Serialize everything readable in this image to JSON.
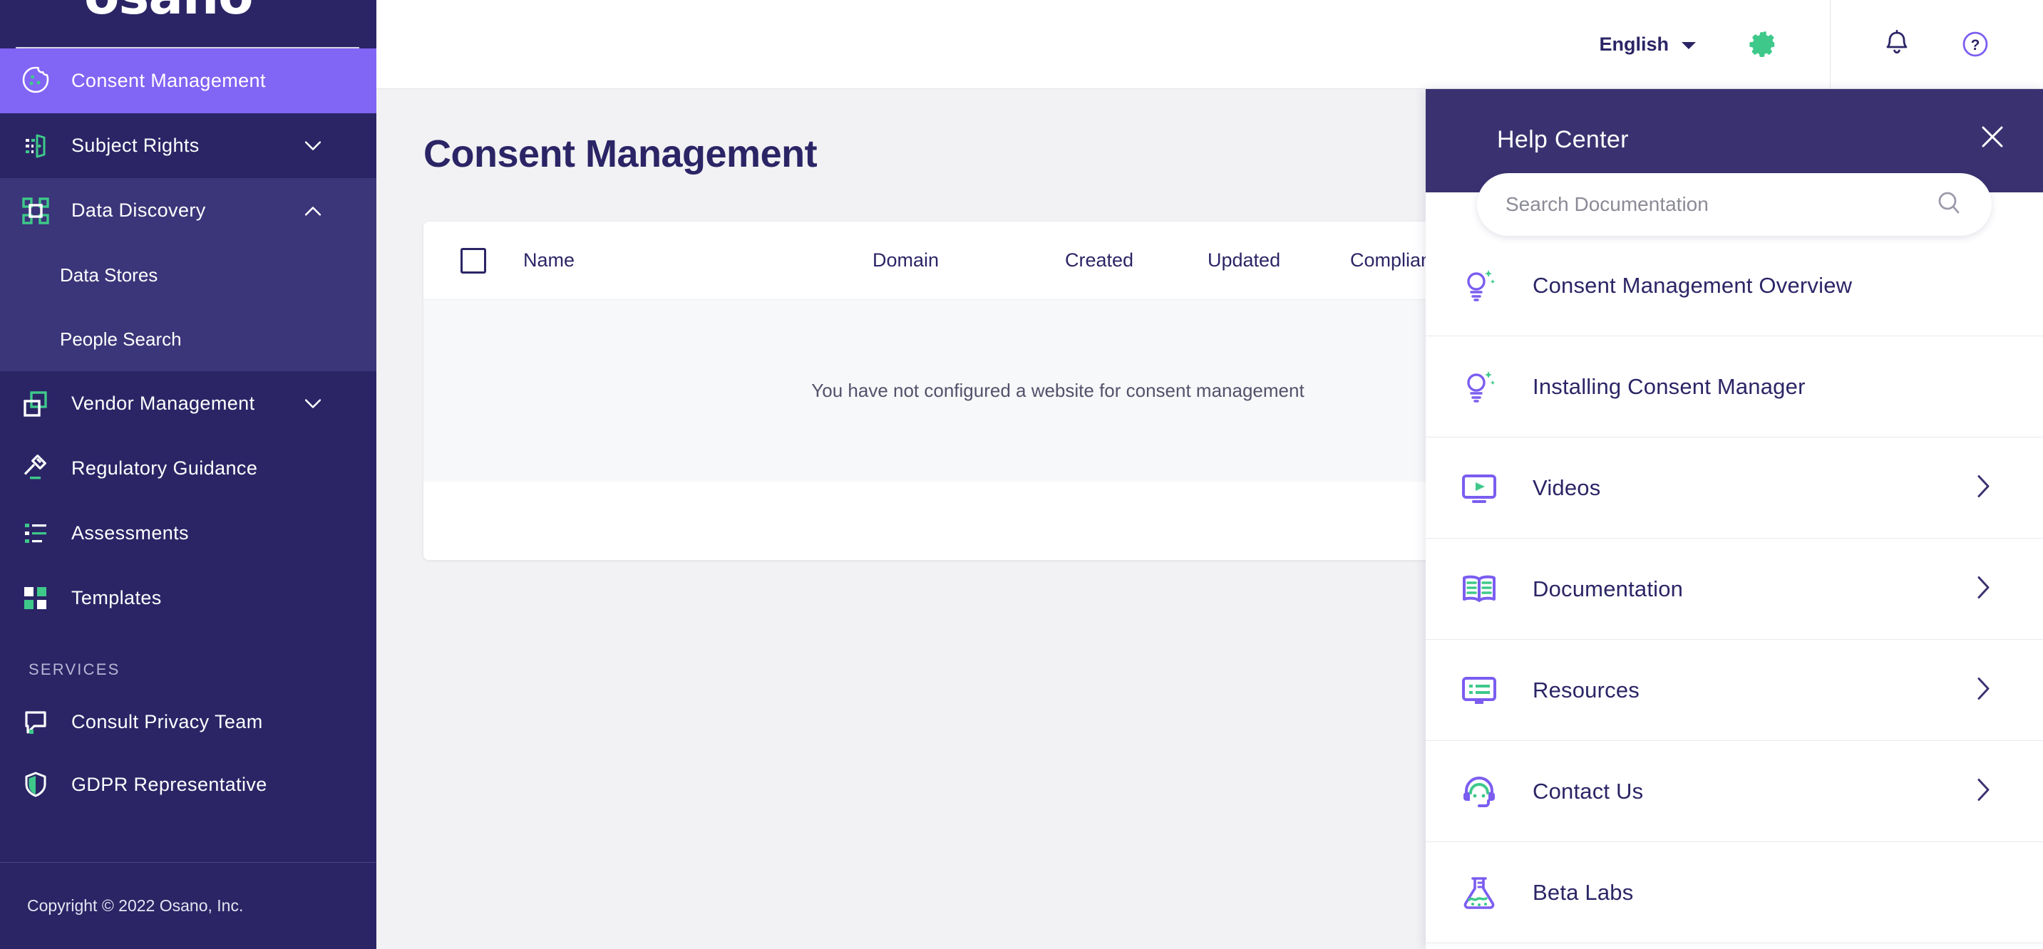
{
  "brand": {
    "logo_text": "osano",
    "accent_purple": "#8165f4",
    "accent_green": "#3ec98a",
    "dark_navy": "#2b2566",
    "panel_header": "#3a3270"
  },
  "sidebar": {
    "items": [
      {
        "label": "Consent Management",
        "icon": "cookie-icon",
        "active": true,
        "expandable": false
      },
      {
        "label": "Subject Rights",
        "icon": "door-exit-icon",
        "active": false,
        "expandable": true,
        "expanded": false
      },
      {
        "label": "Data Discovery",
        "icon": "scan-frame-icon",
        "active": false,
        "expandable": true,
        "expanded": true
      },
      {
        "label": "Vendor Management",
        "icon": "overlapping-squares-icon",
        "active": false,
        "expandable": true,
        "expanded": false
      },
      {
        "label": "Regulatory Guidance",
        "icon": "gavel-icon",
        "active": false,
        "expandable": false
      },
      {
        "label": "Assessments",
        "icon": "checklist-icon",
        "active": false,
        "expandable": false
      },
      {
        "label": "Templates",
        "icon": "grid-squares-icon",
        "active": false,
        "expandable": false
      }
    ],
    "data_discovery_children": [
      {
        "label": "Data Stores"
      },
      {
        "label": "People Search"
      }
    ],
    "services_heading": "SERVICES",
    "services": [
      {
        "label": "Consult Privacy Team",
        "icon": "speech-bubble-icon"
      },
      {
        "label": "GDPR Representative",
        "icon": "shield-icon"
      }
    ],
    "copyright": "Copyright © 2022 Osano, Inc."
  },
  "topbar": {
    "language": "English",
    "language_chevron": "chevron-down-icon",
    "gear": "gear-icon",
    "bell": "bell-icon",
    "help": "help-circle-icon"
  },
  "main": {
    "page_title": "Consent Management",
    "table": {
      "columns": [
        "Name",
        "Domain",
        "Created",
        "Updated",
        "Compliance"
      ],
      "select_all_checkbox": "unchecked",
      "empty_message": "You have not configured a website for consent management"
    }
  },
  "help_center": {
    "title": "Help Center",
    "close_icon": "close-icon",
    "search": {
      "placeholder": "Search Documentation",
      "value": "",
      "icon": "search-icon"
    },
    "items": [
      {
        "label": "Consent Management Overview",
        "icon": "lightbulb-icon",
        "has_chevron": false
      },
      {
        "label": "Installing Consent Manager",
        "icon": "lightbulb-icon",
        "has_chevron": false
      },
      {
        "label": "Videos",
        "icon": "video-play-icon",
        "has_chevron": true
      },
      {
        "label": "Documentation",
        "icon": "open-book-icon",
        "has_chevron": true
      },
      {
        "label": "Resources",
        "icon": "monitor-list-icon",
        "has_chevron": true
      },
      {
        "label": "Contact Us",
        "icon": "headset-support-icon",
        "has_chevron": true
      },
      {
        "label": "Beta Labs",
        "icon": "flask-icon",
        "has_chevron": false
      }
    ]
  }
}
